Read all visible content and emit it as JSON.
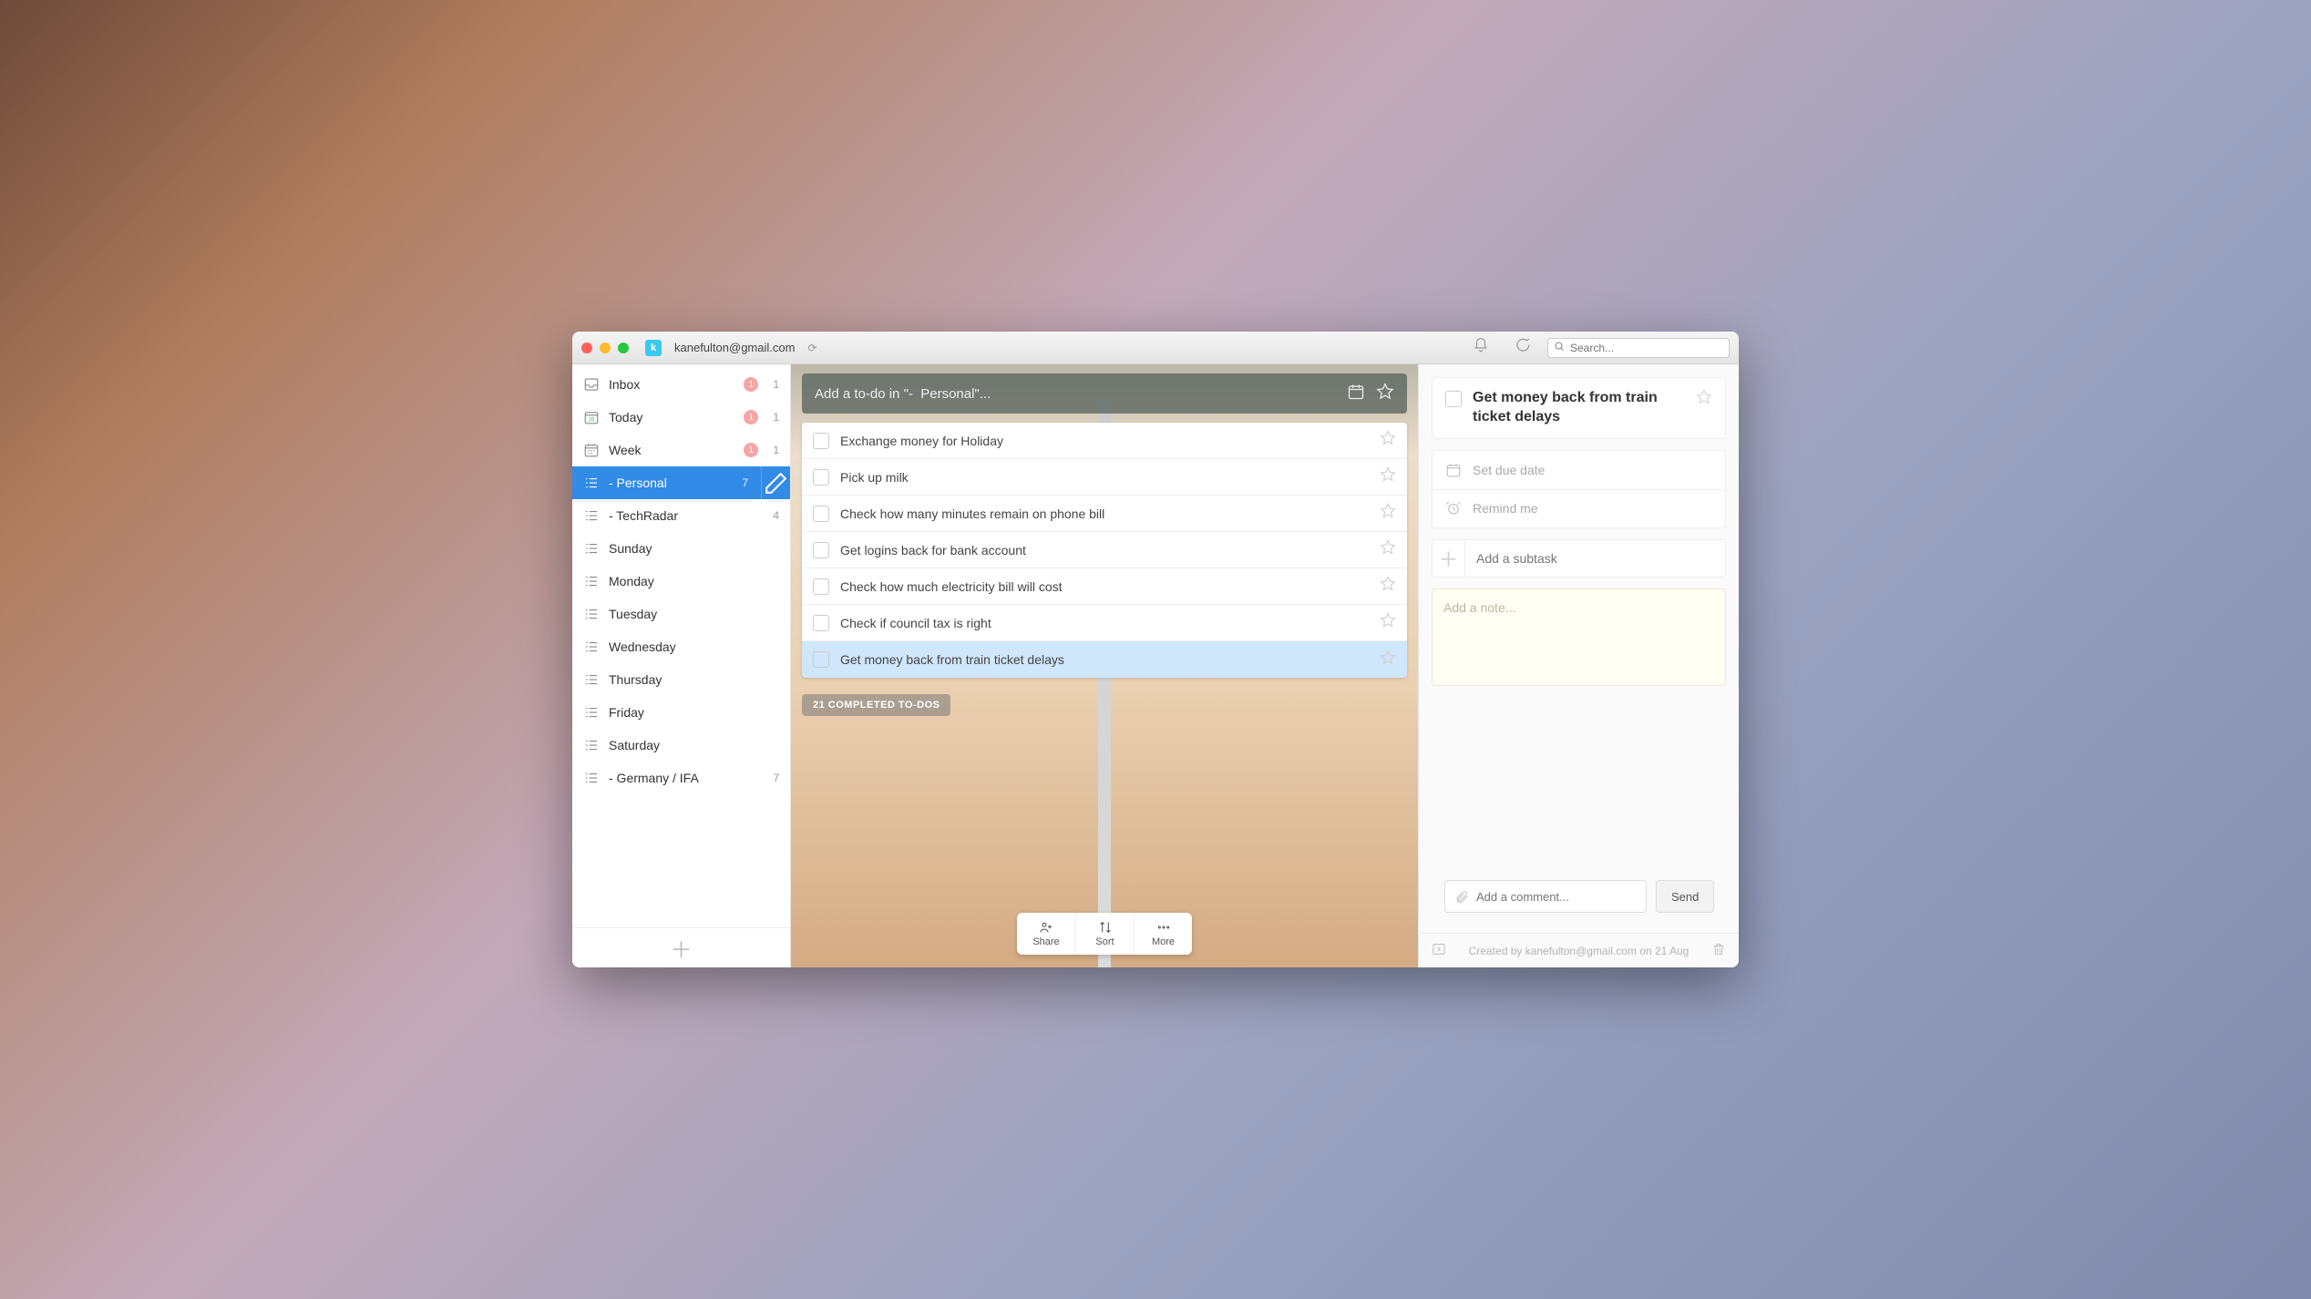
{
  "titlebar": {
    "account_initial": "k",
    "account_email": "kanefulton@gmail.com",
    "search_placeholder": "Search..."
  },
  "sidebar": {
    "items": [
      {
        "id": "inbox",
        "label": "Inbox",
        "icon": "inbox",
        "badge": "1",
        "count": "1"
      },
      {
        "id": "today",
        "label": "Today",
        "icon": "today",
        "badge": "1",
        "count": "1"
      },
      {
        "id": "week",
        "label": "Week",
        "icon": "week",
        "badge": "1",
        "count": "1"
      },
      {
        "id": "personal",
        "label": "-  Personal",
        "icon": "list",
        "count": "7",
        "active": true,
        "editable": true
      },
      {
        "id": "techradar",
        "label": "- TechRadar",
        "icon": "list",
        "count": "4"
      },
      {
        "id": "sunday",
        "label": "Sunday",
        "icon": "list"
      },
      {
        "id": "monday",
        "label": "Monday",
        "icon": "list"
      },
      {
        "id": "tuesday",
        "label": "Tuesday",
        "icon": "list"
      },
      {
        "id": "wednesday",
        "label": "Wednesday",
        "icon": "list"
      },
      {
        "id": "thursday",
        "label": "Thursday",
        "icon": "list"
      },
      {
        "id": "friday",
        "label": "Friday",
        "icon": "list"
      },
      {
        "id": "saturday",
        "label": "Saturday",
        "icon": "list"
      },
      {
        "id": "germany",
        "label": "- Germany / IFA",
        "icon": "list",
        "count": "7"
      }
    ]
  },
  "main": {
    "add_placeholder": "Add a to-do in \"-  Personal\"...",
    "tasks": [
      {
        "title": "Exchange money for Holiday"
      },
      {
        "title": "Pick up milk"
      },
      {
        "title": "Check how many minutes remain on phone bill"
      },
      {
        "title": "Get logins back for bank account"
      },
      {
        "title": "Check how much electricity bill will cost"
      },
      {
        "title": "Check if council tax is right"
      },
      {
        "title": "Get money back from train ticket delays",
        "selected": true
      }
    ],
    "completed_label": "21 COMPLETED TO-DOS",
    "toolbar": {
      "share": "Share",
      "sort": "Sort",
      "more": "More"
    }
  },
  "detail": {
    "title": "Get money back from train ticket delays",
    "due_label": "Set due date",
    "remind_label": "Remind me",
    "subtask_placeholder": "Add a subtask",
    "note_placeholder": "Add a note...",
    "comment_placeholder": "Add a comment...",
    "send_label": "Send",
    "created_by": "Created by kanefulton@gmail.com on 21 Aug"
  }
}
